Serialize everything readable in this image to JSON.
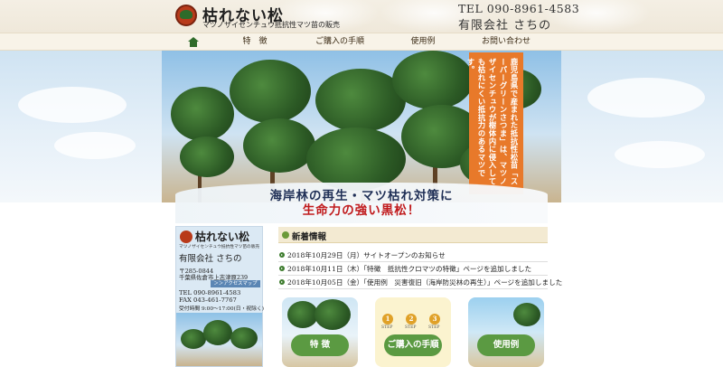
{
  "header": {
    "title": "枯れない松",
    "subtitle": "マツノザイセンチュウ抵抗性マツ苗の販売",
    "tel": "TEL 090-8961-4583",
    "company": "有限会社 さちの"
  },
  "nav": {
    "items": [
      {
        "label": "特　徴"
      },
      {
        "label": "ご購入の手順"
      },
      {
        "label": "使用例"
      },
      {
        "label": "お問い合わせ"
      }
    ]
  },
  "hero": {
    "vertical_text": "鹿児島県で産まれた抵抗性松苗「スーパーグリーンさつま」は、マツノザイセンチュウが樹体内に侵入しても枯れにくい抵抗力のあるマツです。",
    "catch_line1": "海岸林の再生・マツ枯れ対策に",
    "catch_line2": "生命力の強い黒松！"
  },
  "sidebar": {
    "title": "枯れない松",
    "subtitle": "マツノザイセンチュウ抵抗性マツ苗の販売",
    "company": "有限会社 さちの",
    "zip": "〒285-0844",
    "address": "千葉県佐倉市上志津原239",
    "map_link": "＞＞アクセスマップ",
    "tel": "TEL 090-8961-4583",
    "fax": "FAX 043-461-7767",
    "hours": "受付時間 9:00〜17:00(日・祝除く)"
  },
  "news": {
    "heading": "新着情報",
    "items": [
      {
        "text": "2018年10月29日（月）サイトオープンのお知らせ"
      },
      {
        "text": "2018年10月11日（木）「特徴　抵抗性クロマツの特徴」ページを追加しました"
      },
      {
        "text": "2018年10月05日（金）「使用例　災害復旧（海岸防災林の再生）」ページを追加しました"
      }
    ]
  },
  "cards": [
    {
      "label": "特 徴"
    },
    {
      "label": "ご購入の手順",
      "steps": [
        "1",
        "2",
        "3"
      ],
      "step_label": "STEP"
    },
    {
      "label": "使用例"
    }
  ],
  "colors": {
    "accent_orange": "#e8792a",
    "catch_red": "#c0191b",
    "navy": "#1f2f56",
    "green": "#3f7d2f"
  },
  "icons": {
    "home": "home-icon",
    "news_bullet": "circle-arrow-icon",
    "logo": "pine-logo-icon"
  }
}
